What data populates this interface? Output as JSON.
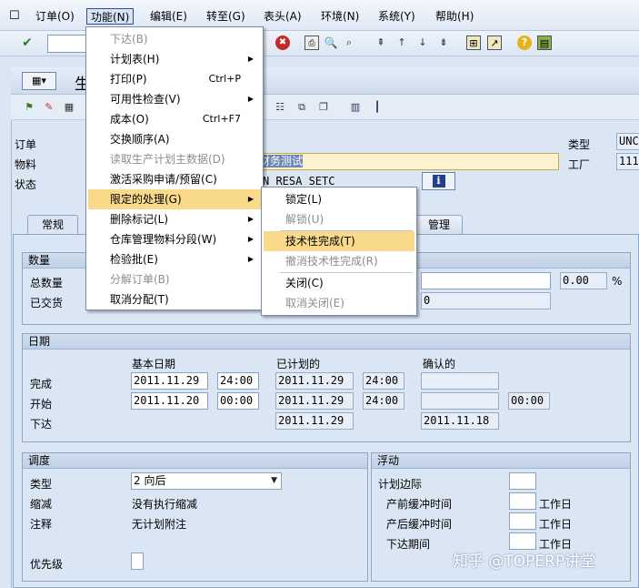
{
  "menubar": {
    "items": [
      "订单(O)",
      "功能(N)",
      "编辑(E)",
      "转至(G)",
      "表头(A)",
      "环境(N)",
      "系统(Y)",
      "帮助(H)"
    ]
  },
  "title": "生",
  "header": {
    "order_label": "订单",
    "material_label": "物料",
    "status_label": "状态",
    "material_desc": "财务测试",
    "status_value": "N RESA SETC",
    "type_label": "类型",
    "type_value": "UNC",
    "plant_label": "工厂",
    "plant_value": "111"
  },
  "tabs": [
    "常规",
    "管理"
  ],
  "function_menu": {
    "items": [
      {
        "label": "下达(B)",
        "disabled": true,
        "shortcut": "",
        "submenu": false
      },
      {
        "label": "计划表(H)",
        "disabled": false,
        "shortcut": "",
        "submenu": true
      },
      {
        "label": "打印(P)",
        "disabled": false,
        "shortcut": "Ctrl+P",
        "submenu": false
      },
      {
        "label": "可用性检查(V)",
        "disabled": false,
        "shortcut": "",
        "submenu": true
      },
      {
        "label": "成本(O)",
        "disabled": false,
        "shortcut": "Ctrl+F7",
        "submenu": false
      },
      {
        "label": "交换顺序(A)",
        "disabled": false,
        "shortcut": "",
        "submenu": false
      },
      {
        "label": "读取生产计划主数据(D)",
        "disabled": true,
        "shortcut": "",
        "submenu": false
      },
      {
        "label": "激活采购申请/预留(C)",
        "disabled": false,
        "shortcut": "",
        "submenu": false
      },
      {
        "label": "限定的处理(G)",
        "disabled": false,
        "shortcut": "",
        "submenu": true,
        "highlighted": true
      },
      {
        "label": "删除标记(L)",
        "disabled": false,
        "shortcut": "",
        "submenu": true
      },
      {
        "label": "仓库管理物料分段(W)",
        "disabled": false,
        "shortcut": "",
        "submenu": true
      },
      {
        "label": "检验批(E)",
        "disabled": false,
        "shortcut": "",
        "submenu": true
      },
      {
        "label": "分解订单(B)",
        "disabled": true,
        "shortcut": "",
        "submenu": false
      },
      {
        "label": "取消分配(T)",
        "disabled": false,
        "shortcut": "",
        "submenu": false
      }
    ]
  },
  "restricted_submenu": {
    "items": [
      {
        "label": "锁定(L)",
        "disabled": false
      },
      {
        "label": "解锁(U)",
        "disabled": true
      },
      {
        "label": "技术性完成(T)",
        "disabled": false,
        "highlighted": true
      },
      {
        "label": "撤消技术性完成(R)",
        "disabled": true
      },
      {
        "label": "关闭(C)",
        "disabled": false
      },
      {
        "label": "取消关闭(E)",
        "disabled": true
      }
    ]
  },
  "quantity": {
    "title": "数量",
    "total_label": "总数量",
    "delivered_label": "已交货",
    "delivered_value": "0",
    "scrap_value": "0.00",
    "scrap_unit": "%"
  },
  "dates": {
    "title": "日期",
    "col_basic": "基本日期",
    "col_scheduled": "已计划的",
    "col_confirmed": "确认的",
    "finish_label": "完成",
    "start_label": "开始",
    "release_label": "下达",
    "finish_basic_date": "2011.11.29",
    "finish_basic_time": "24:00",
    "finish_sched_date": "2011.11.29",
    "finish_sched_time": "24:00",
    "start_basic_date": "2011.11.20",
    "start_basic_time": "00:00",
    "start_sched_date": "2011.11.29",
    "start_sched_time": "24:00",
    "start_conf_time": "00:00",
    "release_sched_date": "2011.11.29",
    "release_conf_date": "2011.11.18"
  },
  "scheduling": {
    "title": "调度",
    "type_label": "类型",
    "type_value": "2 向后",
    "reduction_label": "缩减",
    "reduction_value": "没有执行缩减",
    "note_label": "注释",
    "note_value": "无计划附注",
    "priority_label": "优先级"
  },
  "float": {
    "title": "浮动",
    "margin_label": "计划边际",
    "pre_buffer_label": "产前缓冲时间",
    "post_buffer_label": "产后缓冲时间",
    "release_period_label": "下达期间",
    "unit": "工作日"
  },
  "watermark": "知乎 @TOPERP讲堂"
}
